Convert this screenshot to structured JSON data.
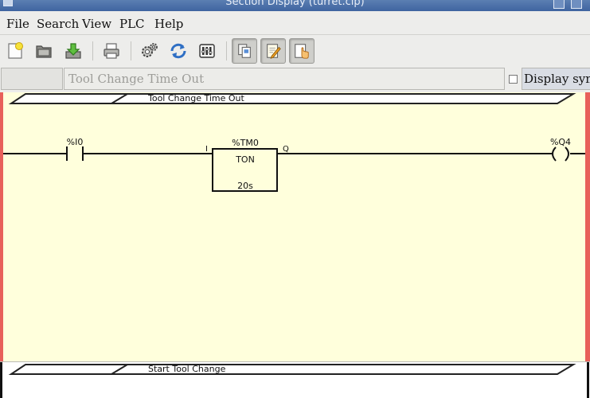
{
  "window": {
    "title": "Section Display (turret.clp)"
  },
  "menu": {
    "file": "File",
    "search": "Search",
    "view": "View",
    "plc": "PLC",
    "help": "Help"
  },
  "toolbar": {
    "icons": [
      "new-section-icon",
      "open-file-icon",
      "save-download-icon",
      "print-icon",
      "config-gear-icon",
      "refresh-icon",
      "io-variables-icon",
      "copy-sections-icon",
      "edit-section-icon",
      "select-pointer-icon"
    ]
  },
  "section_bar": {
    "section_name": "",
    "comment_placeholder": "Tool Change Time Out",
    "display_symbols_label": "Display symbols",
    "display_symbols_checked": false
  },
  "rungs": [
    {
      "comment": "Tool Change Time Out",
      "contact_label": "%I0",
      "timer": {
        "name": "%TM0",
        "type": "TON",
        "preset": "20s",
        "input_label": "I",
        "output_label": "Q"
      },
      "coil_label": "%Q4"
    },
    {
      "comment": "Start Tool Change"
    }
  ],
  "colors": {
    "rung_background": "#ffffdc",
    "power_rail": "#e8605a",
    "titlebar": "#4a6ea8"
  }
}
